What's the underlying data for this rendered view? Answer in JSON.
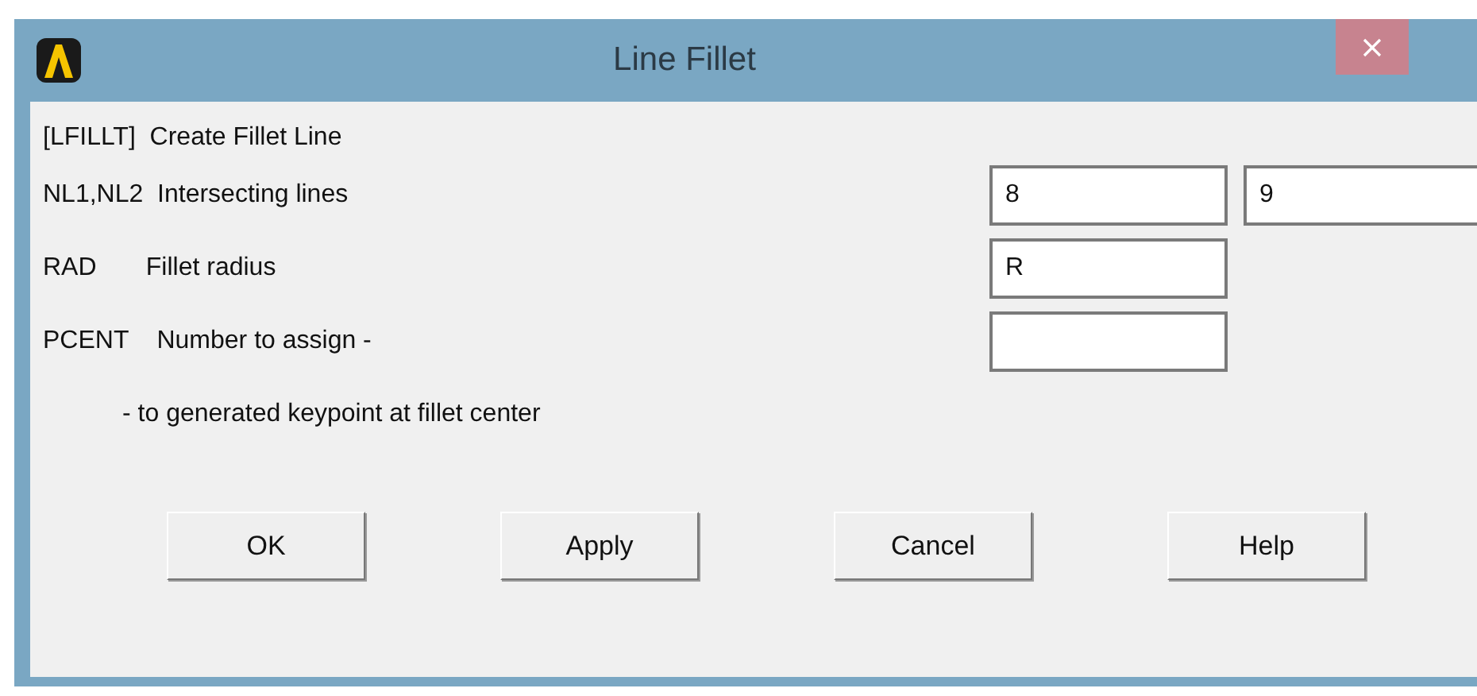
{
  "window": {
    "title": "Line Fillet"
  },
  "command": "[LFILLT]  Create Fillet Line",
  "parameters": [
    {
      "label": "NL1,NL2  Intersecting lines",
      "fields": [
        {
          "kind": "text",
          "value": "8"
        },
        {
          "kind": "text",
          "value": "9"
        }
      ]
    },
    {
      "label": "RAD       Fillet radius",
      "fields": [
        {
          "kind": "text",
          "value": "R"
        }
      ]
    },
    {
      "label": "PCENT    Number to assign -",
      "fields": [
        {
          "kind": "text"
        }
      ]
    }
  ],
  "note": "- to generated keypoint at fillet center",
  "buttons": [
    "OK",
    "Apply",
    "Cancel",
    "Help"
  ]
}
